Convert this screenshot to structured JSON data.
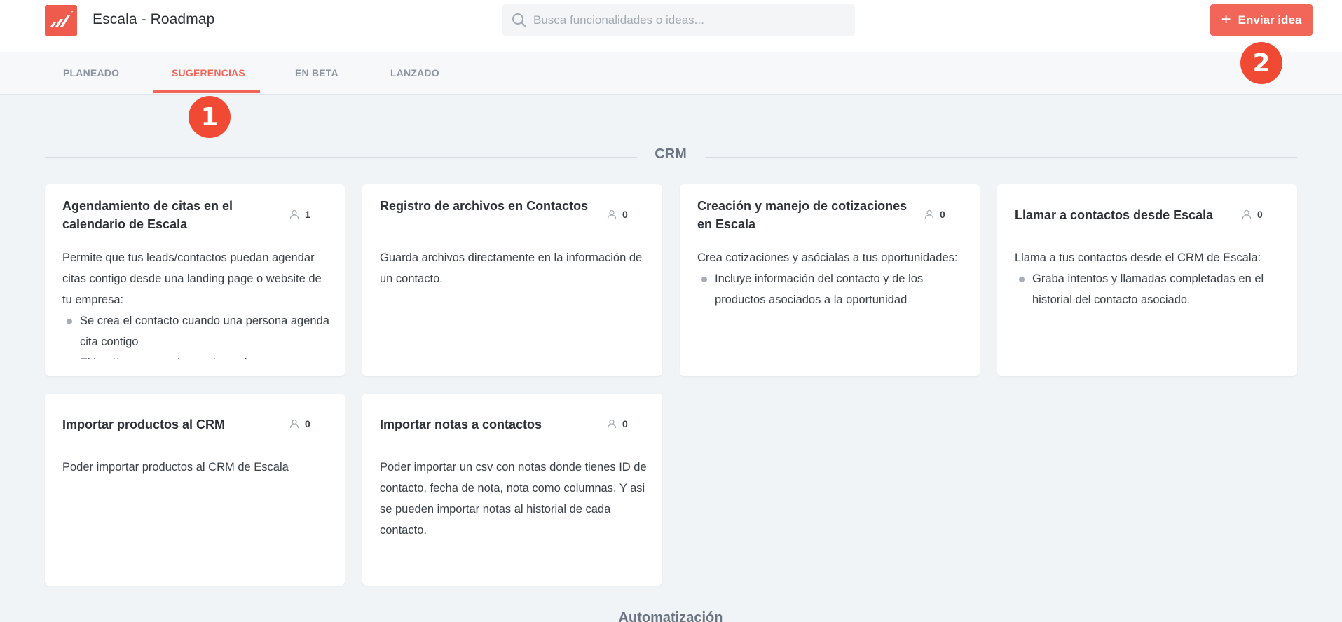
{
  "header": {
    "app_title": "Escala - Roadmap",
    "logo_icon": "escala-logo-icon",
    "search_placeholder": "Busca funcionalidades o ideas...",
    "search_icon": "search-icon",
    "submit_label": "Enviar idea",
    "submit_icon": "plus-icon"
  },
  "tabs": [
    {
      "label": "PLANEADO",
      "active": false
    },
    {
      "label": "SUGERENCIAS",
      "active": true
    },
    {
      "label": "EN BETA",
      "active": false
    },
    {
      "label": "LANZADO",
      "active": false
    }
  ],
  "markers": [
    "1",
    "2"
  ],
  "sections": [
    {
      "title": "CRM",
      "cards": [
        {
          "title": "Agendamiento de citas en el calendario de Escala",
          "votes": "1",
          "description": "Permite que tus leads/contactos puedan agendar citas contigo desde una landing page o website de tu empresa:",
          "bullets": [
            "Se crea el contacto cuando una persona agenda cita contigo",
            "El lead/contacto solo puede ver los cupos"
          ]
        },
        {
          "title": "Registro de archivos en Contactos",
          "votes": "0",
          "description": "Guarda archivos directamente en la información de un contacto.",
          "bullets": []
        },
        {
          "title": "Creación y manejo de cotizaciones en Escala",
          "votes": "0",
          "description": "Crea cotizaciones y asócialas a tus oportunidades:",
          "bullets": [
            "Incluye información del contacto y de los productos asociados a la oportunidad"
          ]
        },
        {
          "title": "Llamar a contactos desde Escala",
          "votes": "0",
          "description": "Llama a tus contactos desde el CRM de Escala:",
          "bullets": [
            "Graba intentos y llamadas completadas en el historial del contacto asociado."
          ]
        },
        {
          "title": "Importar productos al CRM",
          "votes": "0",
          "description": "Poder importar productos al CRM de Escala",
          "bullets": []
        },
        {
          "title": "Importar notas a contactos",
          "votes": "0",
          "description": "Poder importar un csv con notas donde tienes ID de contacto, fecha de nota, nota como columnas. Y asi se pueden importar notas al historial de cada contacto.",
          "bullets": []
        }
      ]
    },
    {
      "title": "Automatización",
      "cards": []
    }
  ],
  "colors": {
    "accent": "#f2665a",
    "marker": "#f04a35",
    "background": "#f1f4f7"
  }
}
